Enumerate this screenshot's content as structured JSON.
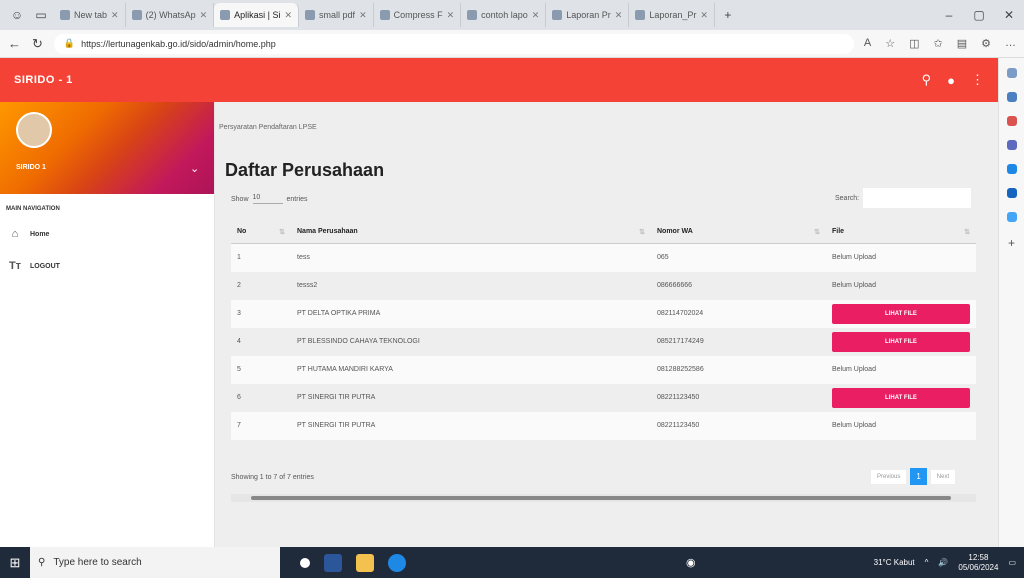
{
  "browser": {
    "tabs": [
      {
        "label": "New tab"
      },
      {
        "label": "(2) WhatsAp"
      },
      {
        "label": "Aplikasi | Si"
      },
      {
        "label": "small pdf"
      },
      {
        "label": "Compress F"
      },
      {
        "label": "contoh lapo"
      },
      {
        "label": "Laporan Pr"
      },
      {
        "label": "Laporan_Pr"
      }
    ],
    "active_tab_index": 2,
    "url": "https://lertunagenkab.go.id/sido/admin/home.php"
  },
  "app": {
    "brand": "SIRIDO - 1",
    "accent": "#f44336"
  },
  "sidebar": {
    "username": "SIRIDO 1",
    "nav_header": "MAIN NAVIGATION",
    "items": [
      {
        "label": "Home",
        "icon": "home-icon"
      },
      {
        "label": "LOGOUT",
        "icon": "text-icon"
      }
    ]
  },
  "main": {
    "breadcrumb": "Persyaratan Pendaftaran LPSE",
    "title": "Daftar Perusahaan",
    "show_label": "Show",
    "show_value": "10",
    "entries_label": "entries",
    "search_label": "Search:",
    "search_value": "",
    "columns": [
      "No",
      "Nama Perusahaan",
      "Nomor WA",
      "File"
    ],
    "rows": [
      {
        "no": "1",
        "nama": "tess",
        "wa": "065",
        "file": "Belum Upload",
        "has_file": false
      },
      {
        "no": "2",
        "nama": "tesss2",
        "wa": "086666666",
        "file": "Belum Upload",
        "has_file": false
      },
      {
        "no": "3",
        "nama": "PT DELTA OPTIKA PRIMA",
        "wa": "082114702024",
        "file": "LIHAT FILE",
        "has_file": true
      },
      {
        "no": "4",
        "nama": "PT BLESSINDO CAHAYA TEKNOLOGI",
        "wa": "085217174249",
        "file": "LIHAT FILE",
        "has_file": true
      },
      {
        "no": "5",
        "nama": "PT HUTAMA MANDIRI KARYA",
        "wa": "081288252586",
        "file": "Belum Upload",
        "has_file": false
      },
      {
        "no": "6",
        "nama": "PT SINERGI TIR PUTRA",
        "wa": "08221123450",
        "file": "LIHAT FILE",
        "has_file": true
      },
      {
        "no": "7",
        "nama": "PT SINERGI TIR PUTRA",
        "wa": "08221123450",
        "file": "Belum Upload",
        "has_file": false
      }
    ],
    "showing": "Showing 1 to 7 of 7 entries",
    "pager": {
      "previous": "Previous",
      "current": "1",
      "next": "Next"
    }
  },
  "taskbar": {
    "search_placeholder": "Type here to search",
    "weather": "31°C  Kabut",
    "time": "12:58",
    "date": "05/06/2024"
  }
}
